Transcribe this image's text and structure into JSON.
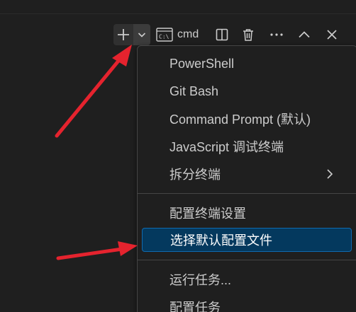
{
  "toolbar": {
    "new_terminal_icon": "plus-icon",
    "launch_profile_icon": "chevron-down-icon",
    "terminal_name": "cmd",
    "terminal_icon": "terminal-cmd-icon",
    "terminal_icon_text": "C:\\",
    "split_icon": "split-editor-icon",
    "kill_icon": "trash-icon",
    "more_icon": "ellipsis-icon",
    "maximize_icon": "chevron-up-icon",
    "close_icon": "close-icon"
  },
  "menu": {
    "items": [
      {
        "label": "PowerShell"
      },
      {
        "label": "Git Bash"
      },
      {
        "label": "Command Prompt (默认)"
      },
      {
        "label": "JavaScript 调试终端"
      },
      {
        "label": "拆分终端",
        "has_submenu": true
      },
      {
        "label": "配置终端设置"
      },
      {
        "label": "选择默认配置文件",
        "selected": true
      },
      {
        "label": "运行任务..."
      },
      {
        "label": "配置任务"
      }
    ]
  },
  "colors": {
    "background": "#1f1f1f",
    "selected_bg": "#04395e",
    "selected_border": "#0f6ab0",
    "annotation_arrow": "#e5232e"
  }
}
